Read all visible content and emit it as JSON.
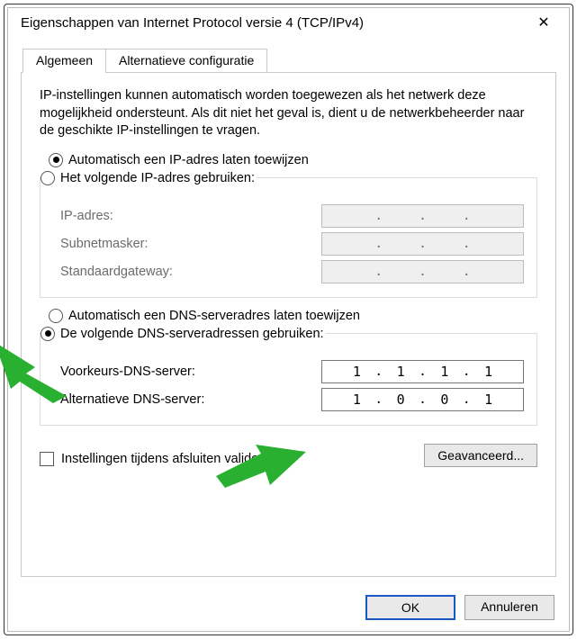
{
  "window": {
    "title": "Eigenschappen van Internet Protocol versie 4 (TCP/IPv4)"
  },
  "tabs": {
    "general": "Algemeen",
    "alternative": "Alternatieve configuratie"
  },
  "description": "IP-instellingen kunnen automatisch worden toegewezen als het netwerk deze mogelijkheid ondersteunt. Als dit niet het geval is, dient u de netwerkbeheerder naar de geschikte IP-instellingen te vragen.",
  "ip": {
    "auto_label": "Automatisch een IP-adres laten toewijzen",
    "manual_label": "Het volgende IP-adres gebruiken:",
    "ip_label": "IP-adres:",
    "mask_label": "Subnetmasker:",
    "gw_label": "Standaardgateway:"
  },
  "dns": {
    "auto_label": "Automatisch een DNS-serveradres laten toewijzen",
    "manual_label": "De volgende DNS-serveradressen gebruiken:",
    "pref_label": "Voorkeurs-DNS-server:",
    "alt_label": "Alternatieve DNS-server:",
    "pref_value": {
      "a": "1",
      "b": "1",
      "c": "1",
      "d": "1"
    },
    "alt_value": {
      "a": "1",
      "b": "0",
      "c": "0",
      "d": "1"
    }
  },
  "validate_label": "Instellingen tijdens afsluiten valideren",
  "advanced_label": "Geavanceerd...",
  "ok_label": "OK",
  "cancel_label": "Annuleren"
}
